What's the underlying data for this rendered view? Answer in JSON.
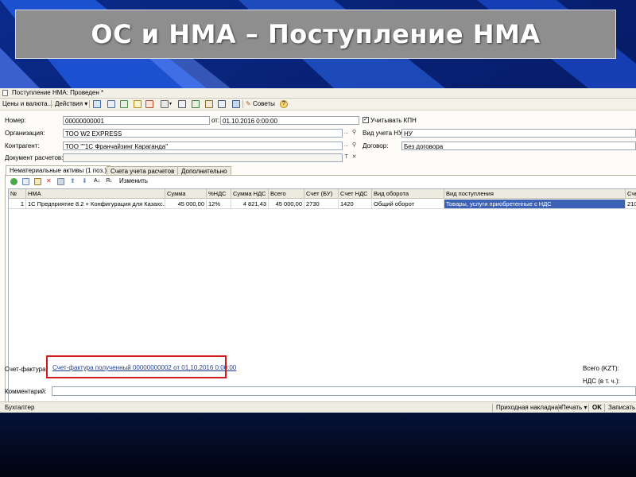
{
  "slide": {
    "title": "ОС и НМА – Поступление НМА"
  },
  "window": {
    "title": "Поступление НМА: Проведен *",
    "toolbar": {
      "prices_menu": "Цены и валюта...",
      "actions_menu": "Действия",
      "advice": "Советы"
    }
  },
  "form": {
    "number_label": "Номер:",
    "number_value": "00000000001",
    "date_label": "от:",
    "date_value": "01.10.2016  0:00:00",
    "kpn_label": "Учитывать КПН",
    "kpn_checked": true,
    "org_label": "Организация:",
    "org_value": "ТОО W2 EXPRESS",
    "nu_label": "Вид учета НУ:",
    "nu_value": "НУ",
    "contractor_label": "Контрагент:",
    "contractor_value": "ТОО \"\"1С Франчайзинг Караганда\"",
    "contract_label": "Договор:",
    "contract_value": "Без договора",
    "settlement_label": "Документ расчетов:",
    "settlement_value": ""
  },
  "tabs": [
    {
      "label": "Нематериальные активы (1 поз.)",
      "active": true
    },
    {
      "label": "Счета учета расчетов",
      "active": false
    },
    {
      "label": "Дополнительно",
      "active": false
    }
  ],
  "table_toolbar": {
    "edit_label": "Изменить"
  },
  "table": {
    "columns": [
      "№",
      "НМА",
      "Сумма",
      "%НДС",
      "Сумма НДС",
      "Всего",
      "Счет (БУ)",
      "Счет НДС",
      "Вид оборота",
      "Вид поступления",
      "Сче"
    ],
    "rows": [
      [
        "1",
        "1С Предприятие 8.2 + Конфигурация для Казахс...",
        "45 000,00",
        "12%",
        "4 821,43",
        "45 000,00",
        "2730",
        "1420",
        "Общий оборот",
        "Товары, услуги приобретенные с НДС",
        "210"
      ]
    ]
  },
  "footer": {
    "invoice_label": "Счет-фактура:",
    "invoice_link": "Счет-фактура полученный 00000000002 от 01.10.2016 0:00:00",
    "total_label": "Всего (KZT):",
    "vat_label": "НДС (в т. ч.):",
    "comment_label": "Комментарий:",
    "comment_value": ""
  },
  "statusbar": {
    "responsible": "Бухгалтер",
    "receipt": "Приходная накладная",
    "print": "Печать",
    "ok": "OK",
    "save": "Записать"
  },
  "colors": {
    "highlight": "#d11b1b",
    "selection": "#3d62b5",
    "slide_title_bg": "#8e8e8e"
  }
}
